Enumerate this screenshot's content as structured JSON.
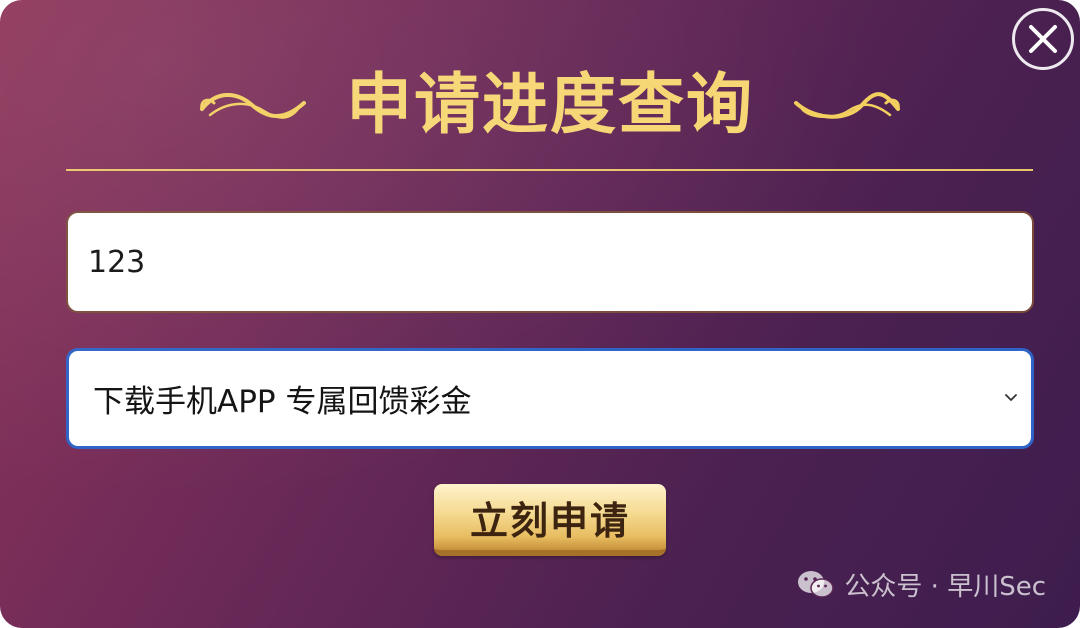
{
  "modal": {
    "title": "申请进度查询",
    "close_icon": "close-icon",
    "input_value": "123",
    "select_selected": "下载手机APP 专属回馈彩金",
    "submit_label": "立刻申请"
  },
  "watermark": {
    "icon": "wechat-icon",
    "text": "公众号 · 早川Sec"
  },
  "colors": {
    "title": "#f6d673",
    "divider": "#e9c66a",
    "select_focus_border": "#2f63c7",
    "background_start": "#8e3559",
    "background_end": "#3d1d4e"
  }
}
